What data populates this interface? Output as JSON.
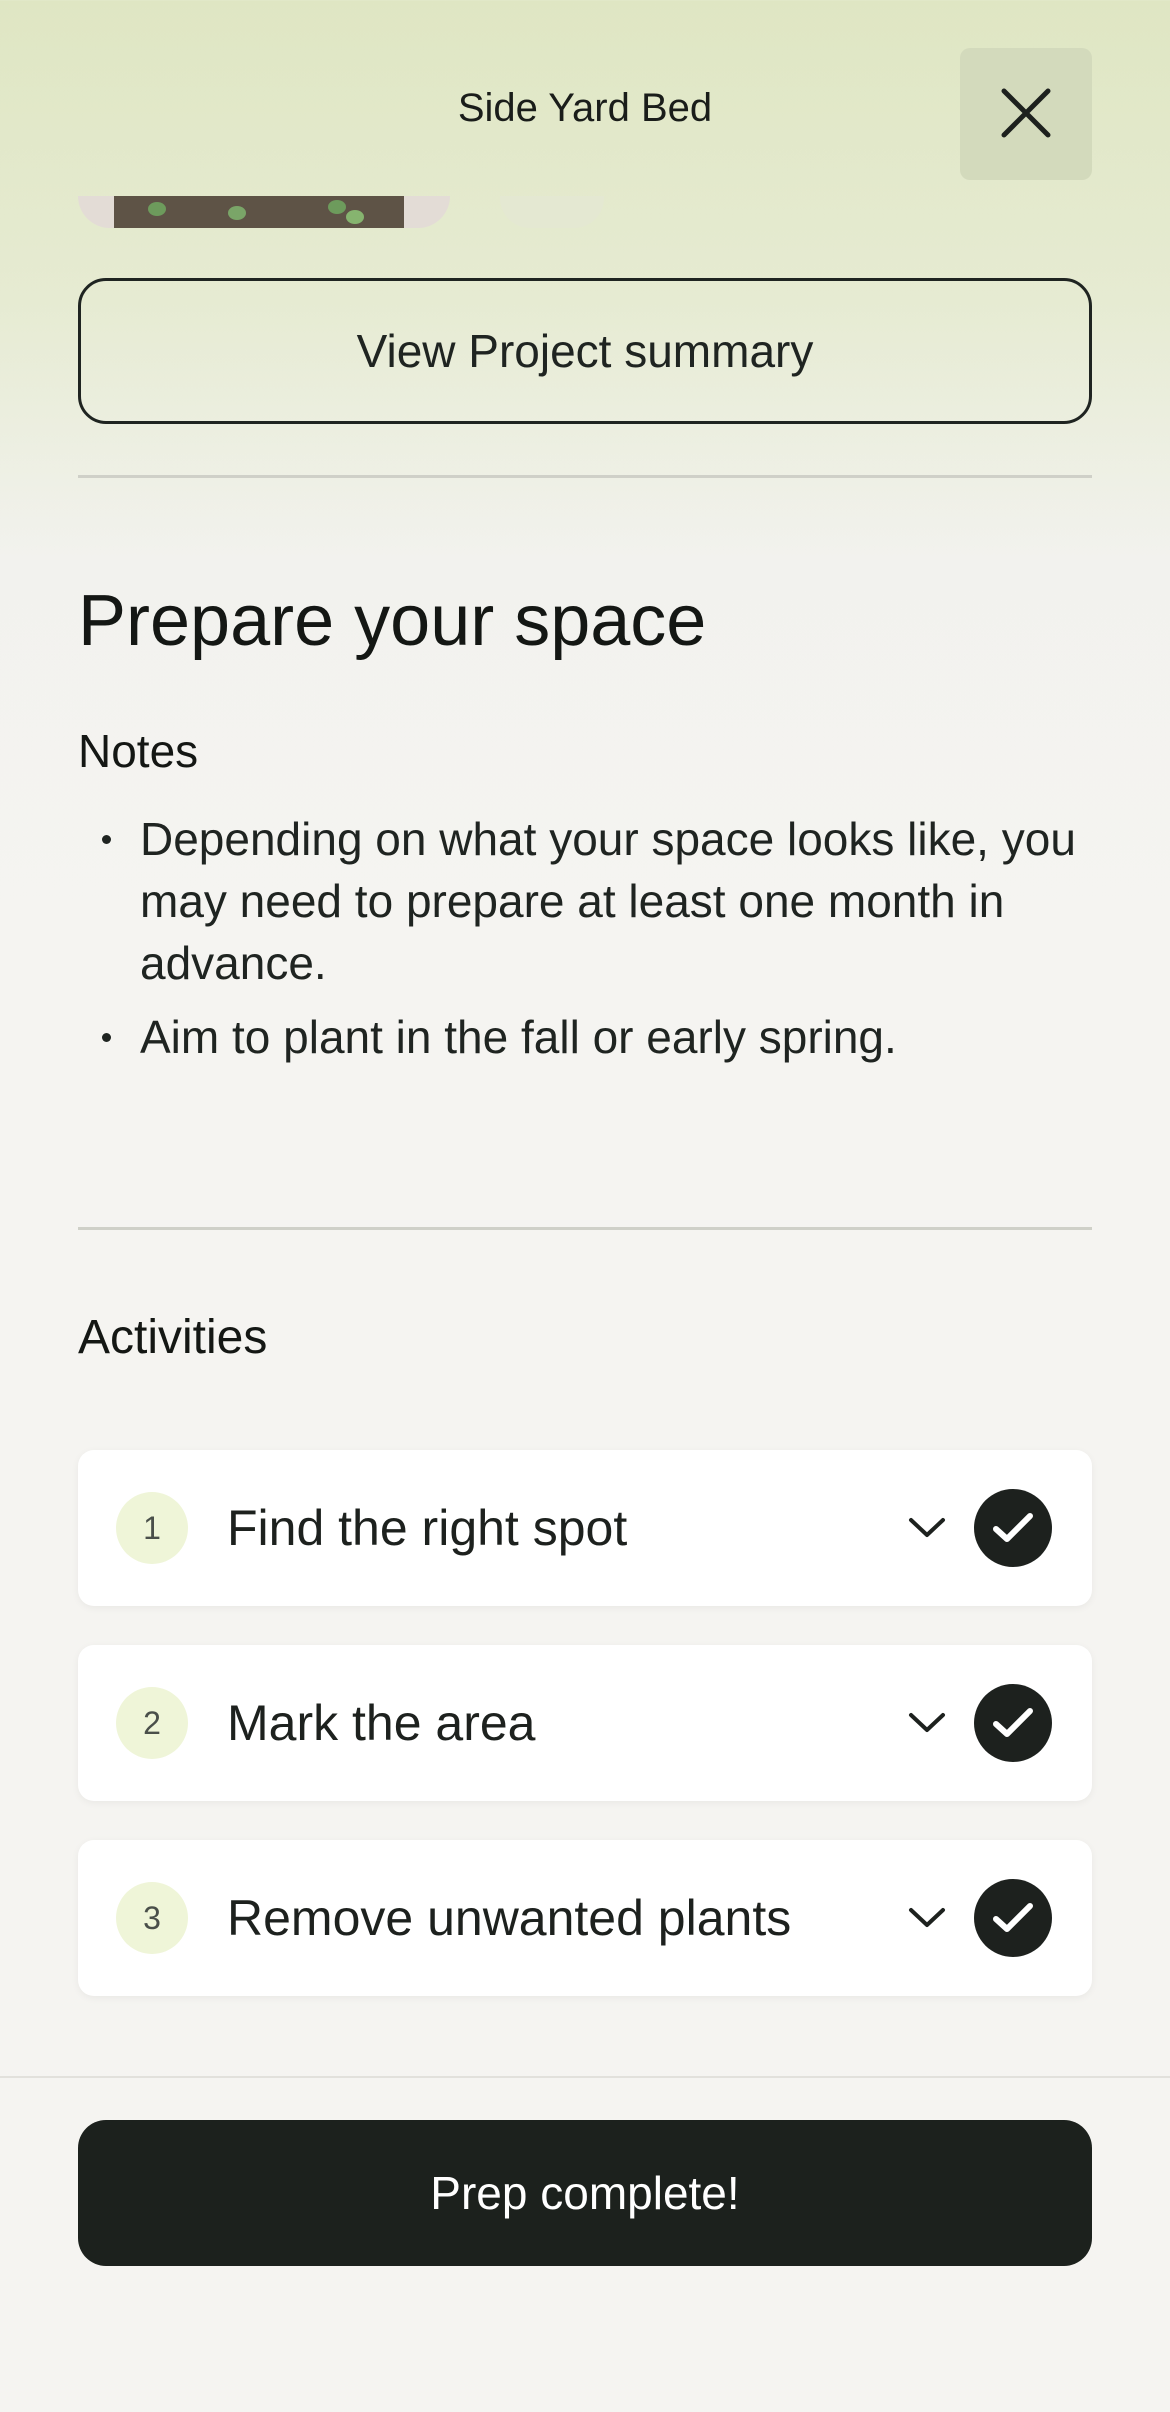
{
  "header": {
    "title": "Side Yard Bed",
    "close_icon": "close-icon"
  },
  "summary_button": {
    "label": "View Project summary"
  },
  "section": {
    "title": "Prepare your space",
    "notes_label": "Notes",
    "notes": [
      "Depending on what your space looks like, you may need to prepare at least one month in advance.",
      "Aim to plant in the fall or early spring."
    ]
  },
  "activities": {
    "label": "Activities",
    "items": [
      {
        "number": "1",
        "title": "Find the right spot",
        "expand_icon": "chevron-down-icon",
        "status_icon": "check-icon"
      },
      {
        "number": "2",
        "title": "Mark the area",
        "expand_icon": "chevron-down-icon",
        "status_icon": "check-icon"
      },
      {
        "number": "3",
        "title": "Remove unwanted plants",
        "expand_icon": "chevron-down-icon",
        "status_icon": "check-icon"
      }
    ]
  },
  "footer": {
    "primary_button": "Prep complete!"
  },
  "colors": {
    "header_gradient_top": "#dfe6c3",
    "background": "#f5f4f1",
    "dark": "#1c211d",
    "badge": "#eff5d8",
    "close_button": "#d3dabc"
  }
}
